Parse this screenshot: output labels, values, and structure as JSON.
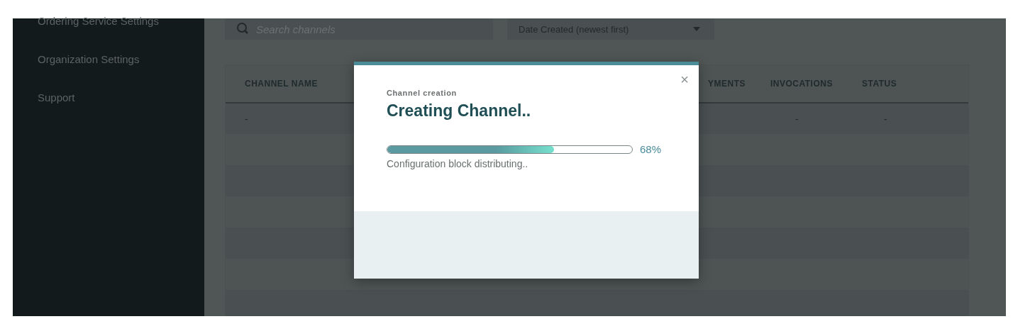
{
  "sidebar": {
    "items": [
      {
        "label": "Ordering Service Settings"
      },
      {
        "label": "Organization Settings"
      },
      {
        "label": "Support"
      }
    ]
  },
  "search": {
    "placeholder": "Search channels"
  },
  "sort": {
    "value": "Date Created (newest first)"
  },
  "table": {
    "columns": [
      "CHANNEL NAME",
      "YMENTS",
      "INVOCATIONS",
      "STATUS"
    ],
    "rows": [
      {
        "channel_name": "-",
        "invocations": "-",
        "status": "-"
      }
    ]
  },
  "modal": {
    "subtitle": "Channel creation",
    "title": "Creating Channel..",
    "close": "×",
    "progress": {
      "level": 0.68,
      "reading": "68%"
    },
    "message": "Configuration block distributing.."
  }
}
